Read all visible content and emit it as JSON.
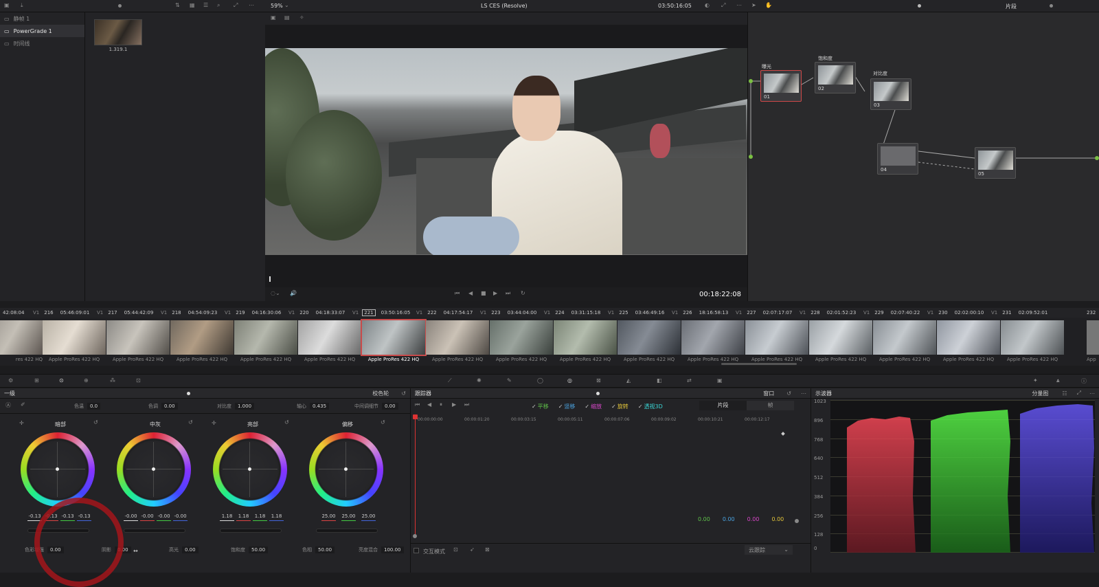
{
  "topbar": {
    "zoom": "59%",
    "project_title": "LS CES (Resolve)",
    "timecode": "03:50:16:05",
    "mode_label": "片段"
  },
  "gallery": {
    "albums": [
      {
        "label": "静帧 1"
      },
      {
        "label": "PowerGrade 1"
      },
      {
        "label": "时间线"
      }
    ],
    "still_label": "1.319.1"
  },
  "viewer": {
    "duration": "00:18:22:08"
  },
  "nodes": [
    {
      "title": "曝光",
      "label": "01"
    },
    {
      "title": "饱和度",
      "label": "02"
    },
    {
      "title": "对比度",
      "label": "03"
    },
    {
      "title": "",
      "label": "04"
    },
    {
      "title": "",
      "label": "05"
    }
  ],
  "timeline": {
    "clips": [
      {
        "num": "216",
        "tc": "05:46:09:01",
        "codec": "Apple ProRes 422 HQ",
        "track": "V1"
      },
      {
        "num": "217",
        "tc": "05:44:42:09",
        "codec": "Apple ProRes 422 HQ",
        "track": "V1"
      },
      {
        "num": "218",
        "tc": "04:54:09:23",
        "codec": "Apple ProRes 422 HQ",
        "track": "V1"
      },
      {
        "num": "219",
        "tc": "04:16:30:06",
        "codec": "Apple ProRes 422 HQ",
        "track": "V1"
      },
      {
        "num": "220",
        "tc": "04:18:33:07",
        "codec": "Apple ProRes 422 HQ",
        "track": "V1"
      },
      {
        "num": "221",
        "tc": "03:50:16:05",
        "codec": "Apple ProRes 422 HQ",
        "track": "V1"
      },
      {
        "num": "222",
        "tc": "04:17:54:17",
        "codec": "Apple ProRes 422 HQ",
        "track": "V1"
      },
      {
        "num": "223",
        "tc": "03:44:04:00",
        "codec": "Apple ProRes 422 HQ",
        "track": "V1"
      },
      {
        "num": "224",
        "tc": "03:31:15:18",
        "codec": "Apple ProRes 422 HQ",
        "track": "V1"
      },
      {
        "num": "225",
        "tc": "03:46:49:16",
        "codec": "Apple ProRes 422 HQ",
        "track": "V1"
      },
      {
        "num": "226",
        "tc": "18:16:58:13",
        "codec": "Apple ProRes 422 HQ",
        "track": "V1"
      },
      {
        "num": "227",
        "tc": "02:07:17:07",
        "codec": "Apple ProRes 422 HQ",
        "track": "V1"
      },
      {
        "num": "228",
        "tc": "02:01:52:23",
        "codec": "Apple ProRes 422 HQ",
        "track": "V1"
      },
      {
        "num": "229",
        "tc": "02:07:40:22",
        "codec": "Apple ProRes 422 HQ",
        "track": "V1"
      },
      {
        "num": "230",
        "tc": "02:02:00:10",
        "codec": "Apple ProRes 422 HQ",
        "track": "V1"
      },
      {
        "num": "231",
        "tc": "02:09:52:01",
        "codec": "Apple ProRes 422 HQ",
        "track": "V1"
      }
    ],
    "first_tc": "42:08:04",
    "first_codec": "res 422 HQ",
    "last_num": "232",
    "last_codec": "App"
  },
  "primaries": {
    "title": "一级",
    "mode": "校色轮",
    "params": {
      "temp_label": "色温",
      "temp": "0.0",
      "tint_label": "色调",
      "tint": "0.00",
      "contrast_label": "对比度",
      "contrast": "1.000",
      "pivot_label": "轴心",
      "pivot": "0.435",
      "md_label": "中间调细节",
      "md": "0.00"
    },
    "wheels": [
      {
        "title": "暗部",
        "values": [
          "-0.13",
          "-0.13",
          "-0.13",
          "-0.13"
        ]
      },
      {
        "title": "中灰",
        "values": [
          "-0.00",
          "-0.00",
          "-0.00",
          "-0.00"
        ]
      },
      {
        "title": "亮部",
        "values": [
          "1.18",
          "1.18",
          "1.18",
          "1.18"
        ]
      },
      {
        "title": "偏移",
        "values": [
          "25.00",
          "25.00",
          "25.00"
        ]
      }
    ],
    "bottom": {
      "boost_label": "色彩增强",
      "boost": "0.00",
      "shadow_label": "阴影",
      "shadow": "0.00",
      "highlight_label": "高光",
      "highlight": "0.00",
      "sat_label": "饱和度",
      "sat": "50.00",
      "hue_label": "色相",
      "hue": "50.00",
      "lummix_label": "亮度混合",
      "lummix": "100.00"
    }
  },
  "tracker": {
    "title": "跟踪器",
    "window_label": "窗口",
    "checks": [
      {
        "label": "平移",
        "color": "#5fc04a"
      },
      {
        "label": "竖移",
        "color": "#4aa3e0"
      },
      {
        "label": "缩放",
        "color": "#d947c9"
      },
      {
        "label": "旋转",
        "color": "#e2c43a"
      },
      {
        "label": "透视3D",
        "color": "#3ad6d6"
      }
    ],
    "clip_label": "片段",
    "frame_label": "帧",
    "ruler": [
      "00:00:00:00",
      "00:00:01:20",
      "00:00:03:15",
      "00:00:05:11",
      "00:00:07:06",
      "00:00:09:02",
      "00:00:10:21",
      "00:00:12:17"
    ],
    "values": [
      "0.00",
      "0.00",
      "0.00",
      "0.00"
    ],
    "interactive_label": "交互模式",
    "cloud_label": "云跟踪"
  },
  "scope": {
    "title": "示波器",
    "mode": "分量图",
    "ylabels": [
      "1023",
      "896",
      "768",
      "640",
      "512",
      "384",
      "256",
      "128",
      "0"
    ]
  }
}
